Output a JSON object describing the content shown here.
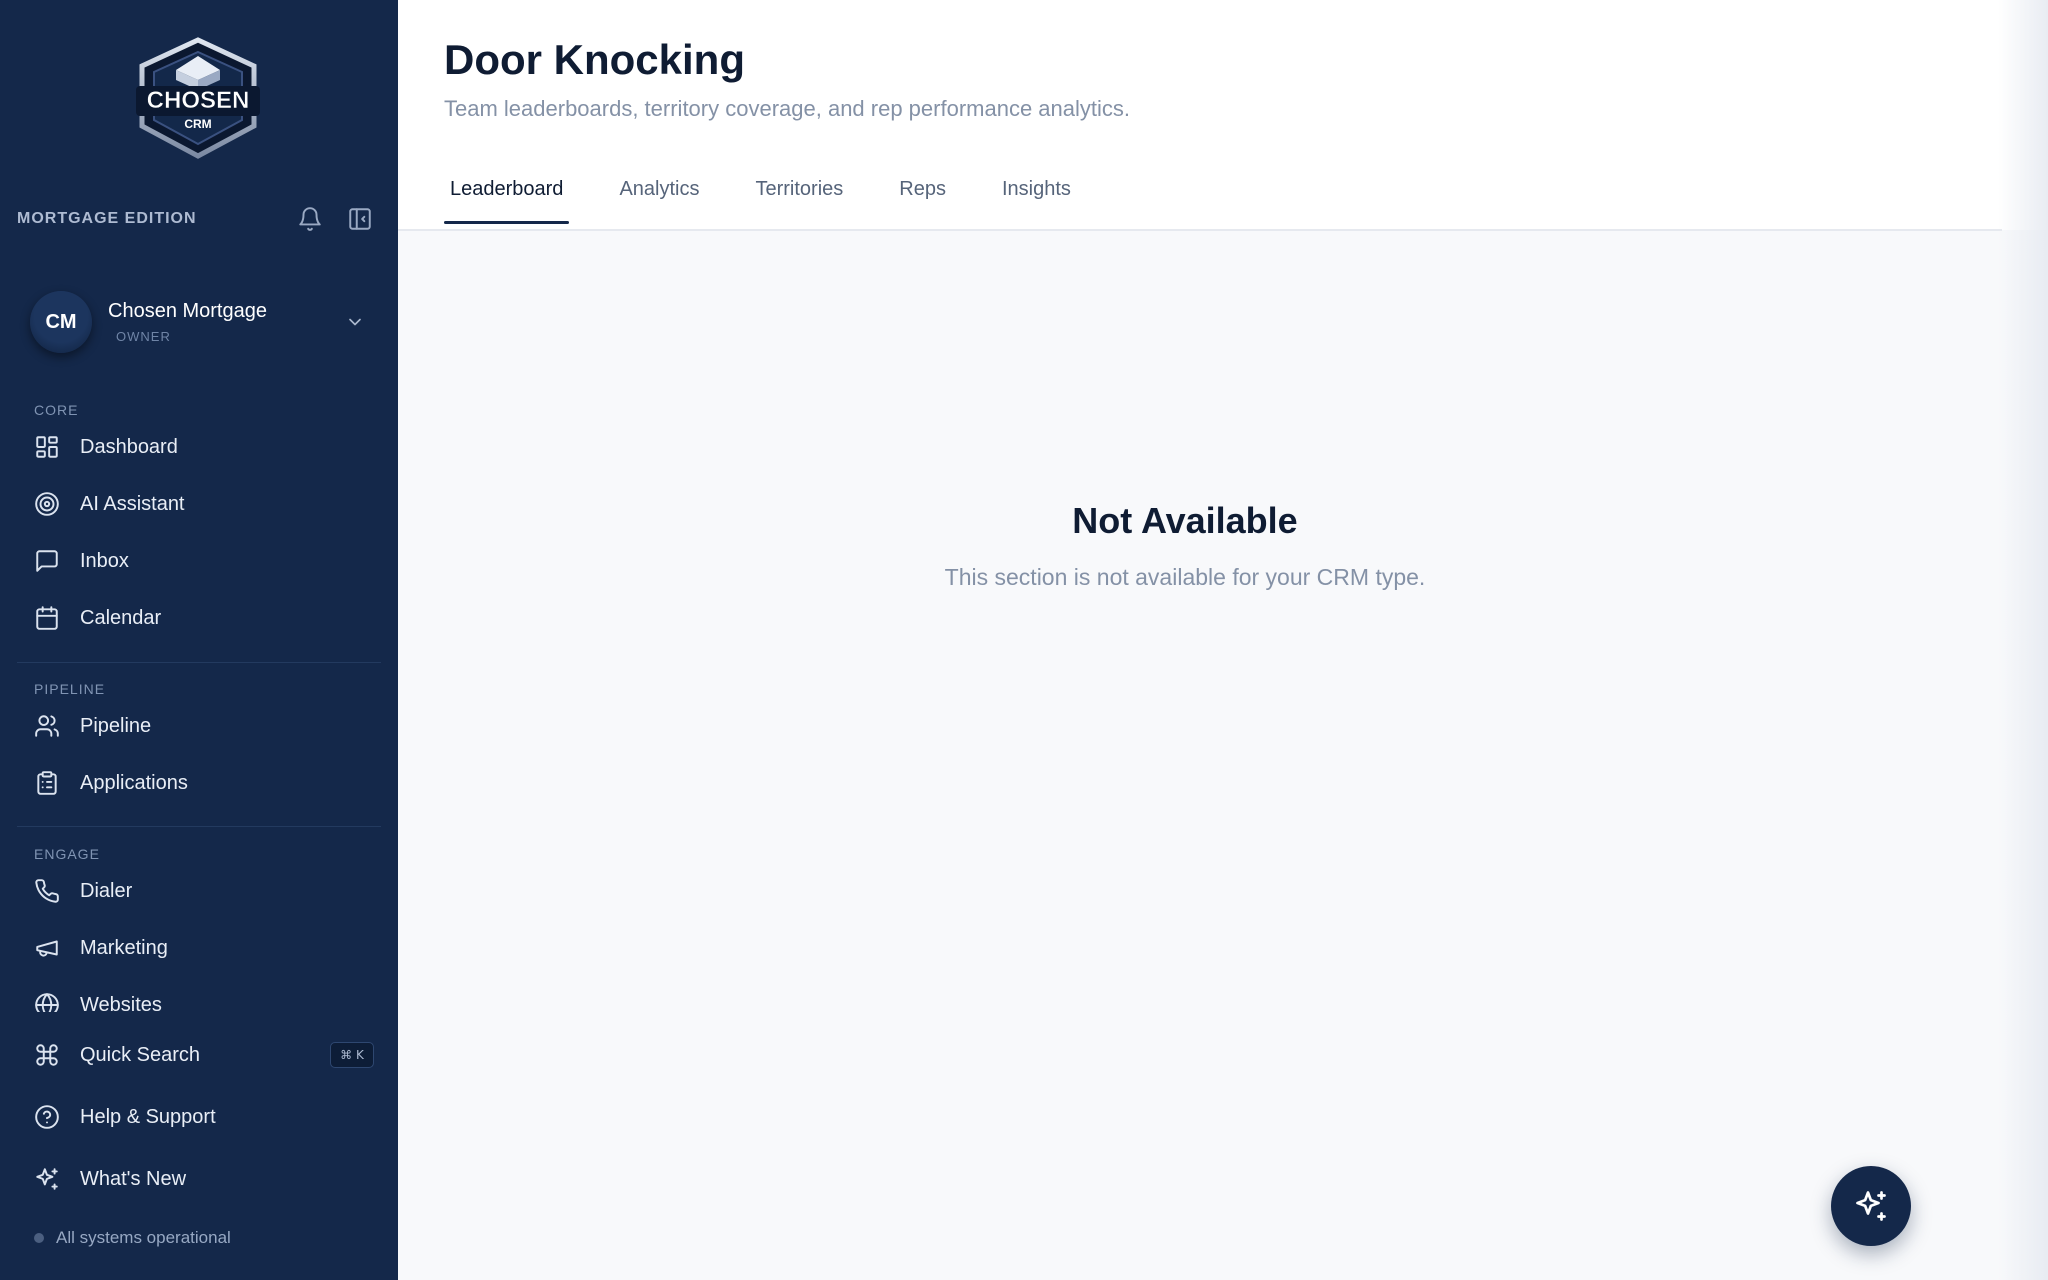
{
  "sidebar": {
    "logo": {
      "line1": "CHOSEN",
      "line2": "CRM"
    },
    "edition": "MORTGAGE EDITION",
    "account": {
      "initials": "CM",
      "name": "Chosen Mortgage",
      "role": "OWNER"
    },
    "sections": {
      "core": "CORE",
      "pipeline": "PIPELINE",
      "engage": "ENGAGE"
    },
    "items": {
      "dashboard": "Dashboard",
      "ai_assistant": "AI Assistant",
      "inbox": "Inbox",
      "calendar": "Calendar",
      "pipeline": "Pipeline",
      "applications": "Applications",
      "dialer": "Dialer",
      "marketing": "Marketing",
      "websites": "Websites"
    },
    "footer": {
      "quick_search": "Quick Search",
      "quick_search_shortcut": "⌘ K",
      "help": "Help & Support",
      "whats_new": "What's New"
    },
    "status": "All systems operational"
  },
  "header": {
    "title": "Door Knocking",
    "subtitle": "Team leaderboards, territory coverage, and rep performance analytics.",
    "tabs": [
      "Leaderboard",
      "Analytics",
      "Territories",
      "Reps",
      "Insights"
    ],
    "active_tab": "Leaderboard"
  },
  "empty_state": {
    "title": "Not Available",
    "text": "This section is not available for your CRM type."
  },
  "colors": {
    "sidebar_bg": "#14284a",
    "accent": "#14284a",
    "main_bg": "#f8f9fb"
  }
}
